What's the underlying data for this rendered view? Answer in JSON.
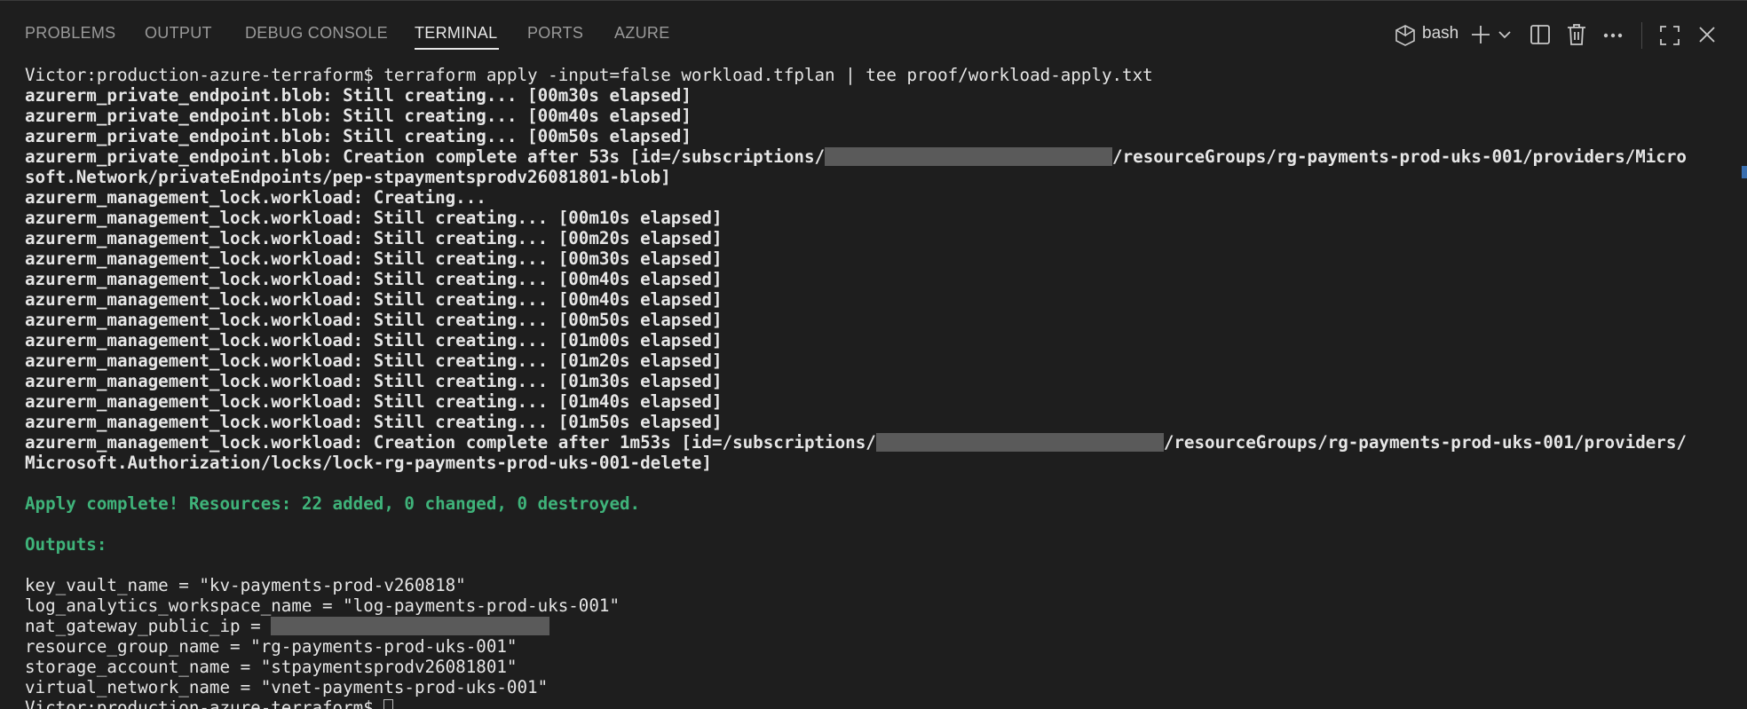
{
  "panel": {
    "tabs": [
      {
        "label": "PROBLEMS"
      },
      {
        "label": "OUTPUT"
      },
      {
        "label": "DEBUG CONSOLE"
      },
      {
        "label": "TERMINAL"
      },
      {
        "label": "PORTS"
      },
      {
        "label": "AZURE"
      }
    ],
    "active_tab": "TERMINAL",
    "shell_label": "bash",
    "icons": {
      "shell": "terminal-shell-icon",
      "new": "plus-icon",
      "dropdown": "chevron-down-icon",
      "split": "split-pane-icon",
      "kill": "trash-icon",
      "more": "ellipsis-icon",
      "maximize": "maximize-icon",
      "close": "close-icon"
    },
    "colors": {
      "background": "#1e1e1e",
      "text": "#e6e6e6",
      "success": "#3fb37a",
      "redaction": "#5a5a5a"
    }
  },
  "terminal": {
    "prompt": "Victor:production-azure-terraform$",
    "command": "terraform apply -input=false workload.tfplan | tee proof/workload-apply.txt",
    "lines": [
      "azurerm_private_endpoint.blob: Still creating... [00m30s elapsed]",
      "azurerm_private_endpoint.blob: Still creating... [00m40s elapsed]",
      "azurerm_private_endpoint.blob: Still creating... [00m50s elapsed]"
    ],
    "pe_complete": {
      "before": "azurerm_private_endpoint.blob: Creation complete after 53s [id=/subscriptions/",
      "after": "/resourceGroups/rg-payments-prod-uks-001/providers/Micro",
      "continuation": "soft.Network/privateEndpoints/pep-stpaymentsprodv26081801-blob]"
    },
    "lock_lines": [
      "azurerm_management_lock.workload: Creating...",
      "azurerm_management_lock.workload: Still creating... [00m10s elapsed]",
      "azurerm_management_lock.workload: Still creating... [00m20s elapsed]",
      "azurerm_management_lock.workload: Still creating... [00m30s elapsed]",
      "azurerm_management_lock.workload: Still creating... [00m40s elapsed]",
      "azurerm_management_lock.workload: Still creating... [00m40s elapsed]",
      "azurerm_management_lock.workload: Still creating... [00m50s elapsed]",
      "azurerm_management_lock.workload: Still creating... [01m00s elapsed]",
      "azurerm_management_lock.workload: Still creating... [01m20s elapsed]",
      "azurerm_management_lock.workload: Still creating... [01m30s elapsed]",
      "azurerm_management_lock.workload: Still creating... [01m40s elapsed]",
      "azurerm_management_lock.workload: Still creating... [01m50s elapsed]"
    ],
    "lock_complete": {
      "before": "azurerm_management_lock.workload: Creation complete after 1m53s [id=/subscriptions/",
      "after": "/resourceGroups/rg-payments-prod-uks-001/providers/",
      "continuation": "Microsoft.Authorization/locks/lock-rg-payments-prod-uks-001-delete]"
    },
    "apply_summary": "Apply complete! Resources: 22 added, 0 changed, 0 destroyed.",
    "outputs_header": "Outputs:",
    "outputs": [
      "key_vault_name = \"kv-payments-prod-v260818\"",
      "log_analytics_workspace_name = \"log-payments-prod-uks-001\"",
      "nat_gateway_public_ip = ",
      "resource_group_name = \"rg-payments-prod-uks-001\"",
      "storage_account_name = \"stpaymentsprodv26081801\"",
      "virtual_network_name = \"vnet-payments-prod-uks-001\""
    ],
    "final_prompt": "Victor:production-azure-terraform$"
  }
}
